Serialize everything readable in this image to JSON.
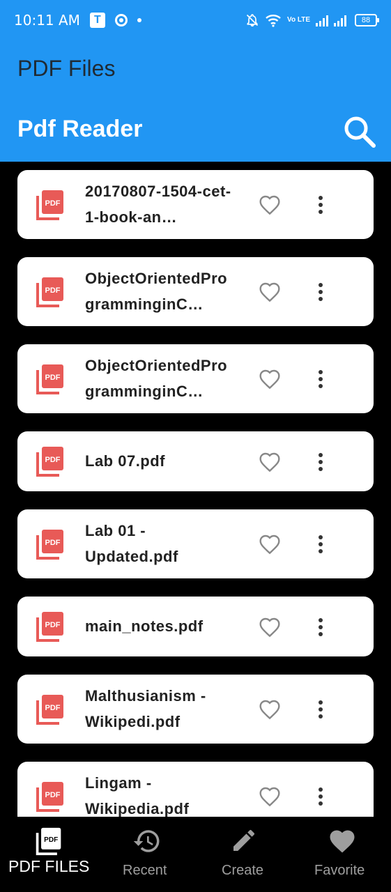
{
  "status_bar": {
    "time": "10:11 AM",
    "network": "Vo LTE",
    "battery": "88"
  },
  "header": {
    "app_title": "PDF Files",
    "screen_title": "Pdf Reader"
  },
  "colors": {
    "primary": "#2196F3",
    "pdf_icon": "#E85A57",
    "background": "#000000",
    "card": "#FFFFFF"
  },
  "files": [
    {
      "name": "20170807-1504-cet-1-book-an…"
    },
    {
      "name": "ObjectOrientedProgramminginC…"
    },
    {
      "name": "ObjectOrientedProgramminginC…"
    },
    {
      "name": "Lab 07.pdf"
    },
    {
      "name": "Lab 01 - Updated.pdf"
    },
    {
      "name": "main_notes.pdf"
    },
    {
      "name": "Malthusianism - Wikipedi.pdf"
    },
    {
      "name": "Lingam - Wikipedia.pdf"
    }
  ],
  "bottom_nav": {
    "pdf_files": "PDF FILES",
    "recent": "Recent",
    "create": "Create",
    "favorite": "Favorite"
  },
  "icons": {
    "search": "search-icon",
    "favorite": "heart-outline-icon",
    "more": "more-vert-icon",
    "pdf": "pdf-file-icon"
  }
}
